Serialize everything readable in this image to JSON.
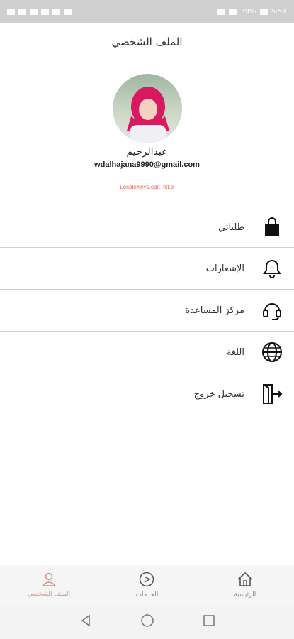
{
  "status_bar": {
    "battery": "39%",
    "time": "5:54"
  },
  "header": {
    "title": "الملف الشخصي"
  },
  "profile": {
    "name": "عبدالرحيم",
    "email": "wdalhajana9990@gmail.com",
    "edit_link": "LocaleKeys.edit_txt.tr"
  },
  "menu": {
    "items": [
      {
        "label": "طلباتي",
        "icon": "shopping-bag-icon"
      },
      {
        "label": "الإشعارات",
        "icon": "bell-icon"
      },
      {
        "label": "مركز المساعدة",
        "icon": "headset-icon"
      },
      {
        "label": "اللغة",
        "icon": "globe-icon"
      },
      {
        "label": "تسجيل خروج",
        "icon": "logout-icon"
      }
    ]
  },
  "bottom_nav": {
    "items": [
      {
        "label": "الملف الشخصي",
        "icon": "user-icon",
        "active": true
      },
      {
        "label": "الخدمات",
        "icon": "services-icon",
        "active": false
      },
      {
        "label": "الرئيسية",
        "icon": "home-icon",
        "active": false
      }
    ]
  },
  "colors": {
    "accent": "#e38a82",
    "divider": "#cfcfcf"
  }
}
